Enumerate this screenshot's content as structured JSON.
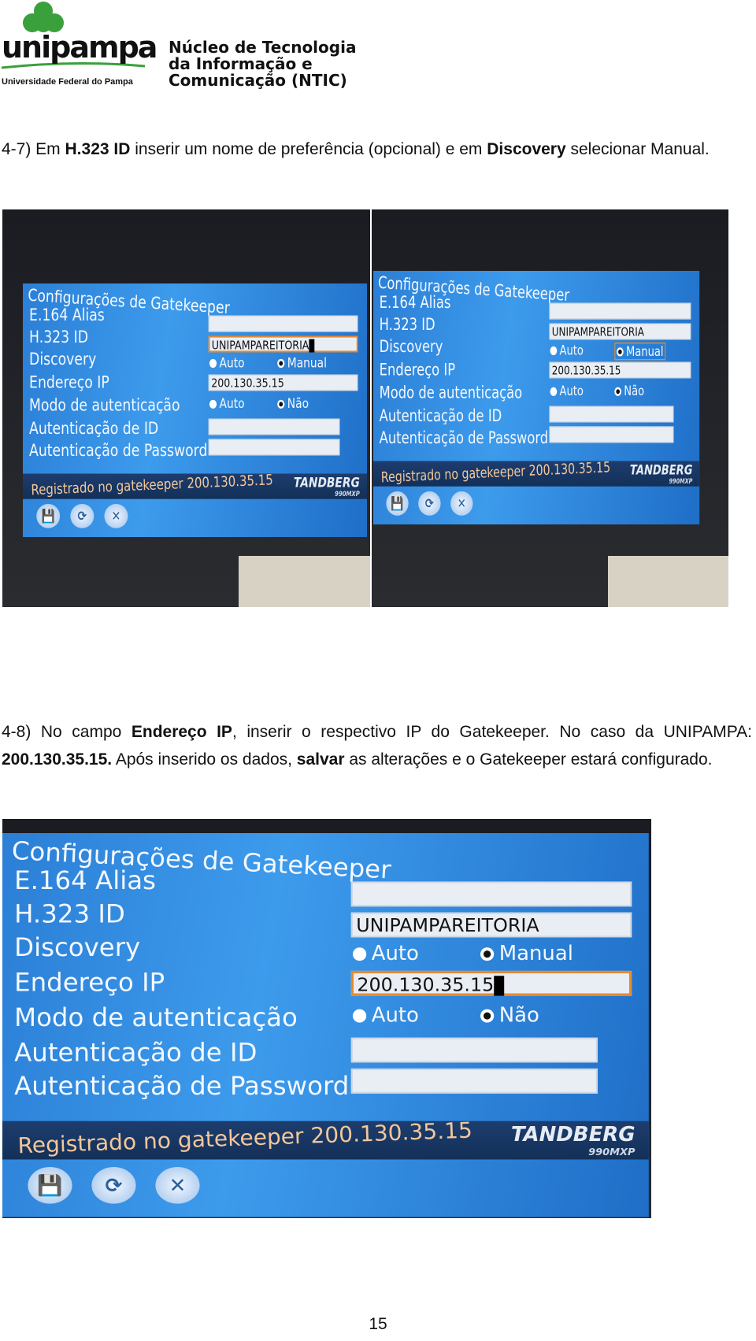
{
  "header": {
    "logo_text": "unipampa",
    "logo_subtitle": "Universidade Federal do Pampa",
    "logo_color": "#3aa03c",
    "ntic_lines": [
      "Núcleo de Tecnologia",
      "da Informação e",
      "Comunicação (NTIC)"
    ]
  },
  "step_4_7": {
    "parts": [
      {
        "t": "4-7) Em ",
        "b": false
      },
      {
        "t": "H.323 ID",
        "b": true
      },
      {
        "t": " inserir um nome de preferência (opcional) e em ",
        "b": false
      },
      {
        "t": "Discovery",
        "b": true
      },
      {
        "t": " selecionar Manual.",
        "b": false
      }
    ]
  },
  "step_4_8": {
    "parts": [
      {
        "t": "4-8) No campo ",
        "b": false
      },
      {
        "t": "Endereço IP",
        "b": true
      },
      {
        "t": ", inserir o respectivo IP do Gatekeeper. No caso da UNIPAMPA: ",
        "b": false
      },
      {
        "t": "200.130.35.15.",
        "b": true
      },
      {
        "t": " Após inserido os dados, ",
        "b": false
      },
      {
        "t": "salvar",
        "b": true
      },
      {
        "t": " as alterações e o Gatekeeper estará configurado.",
        "b": false
      }
    ]
  },
  "screen": {
    "title": "Configurações de Gatekeeper",
    "labels": [
      "E.164 Alias",
      "H.323 ID",
      "Discovery",
      "Endereço IP",
      "Modo de autenticação",
      "Autenticação de ID",
      "Autenticação de Password"
    ],
    "e164_value": "",
    "h323_value": "UNIPAMPAREITORIA",
    "discovery_options": [
      "Auto",
      "Manual"
    ],
    "discovery_selected": "Manual",
    "ip_value": "200.130.35.15",
    "auth_options": [
      "Auto",
      "Não"
    ],
    "auth_selected": "Não",
    "status": "Registrado no gatekeeper 200.130.35.15",
    "brand": "TANDBERG",
    "brand_model": "990MXP",
    "buttons": [
      {
        "icon": "save-icon",
        "glyph": "💾"
      },
      {
        "icon": "refresh-icon",
        "glyph": "⟳"
      },
      {
        "icon": "close-icon",
        "glyph": "✕"
      }
    ],
    "focus_color": "#e8892b"
  },
  "photos": [
    {
      "focus": "h323"
    },
    {
      "focus": "discovery-manual"
    },
    {
      "focus": "ip"
    }
  ],
  "page_number": "15"
}
